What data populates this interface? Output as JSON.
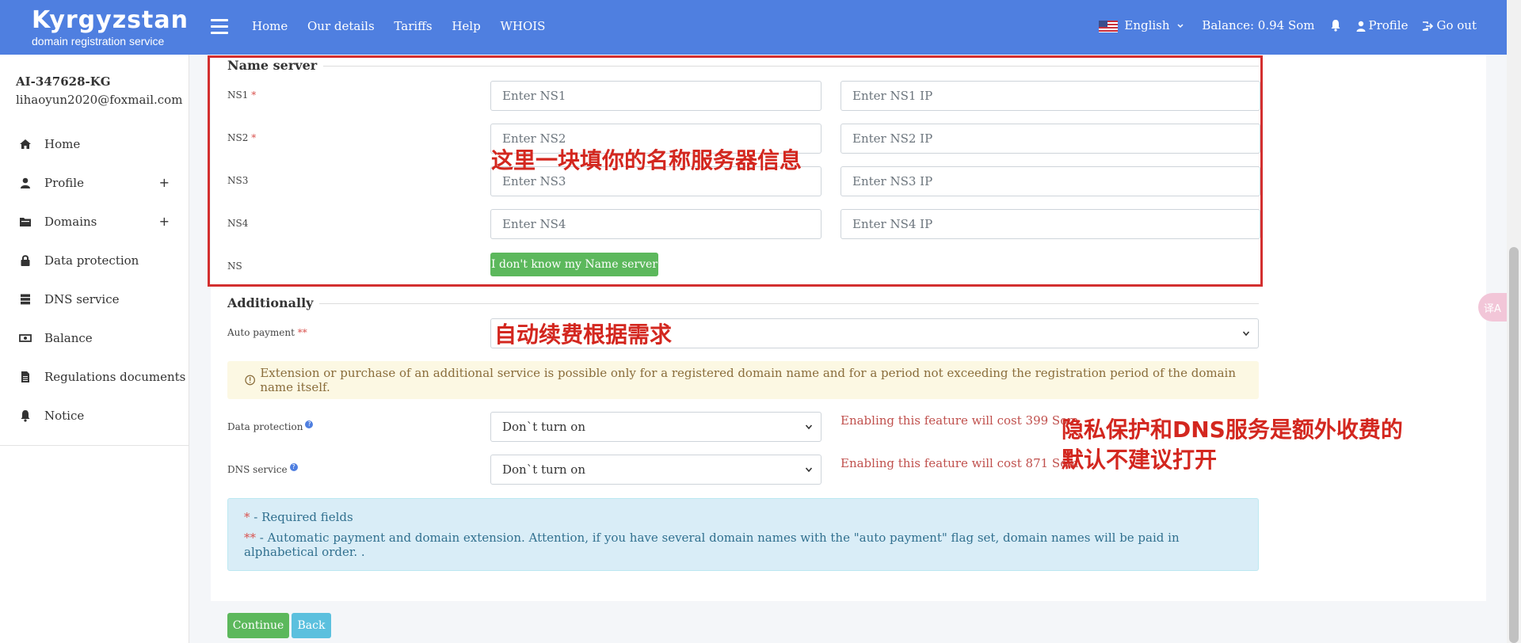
{
  "header": {
    "logo_title": "Kyrgyzstan",
    "logo_subtitle": "domain registration service",
    "nav": [
      "Home",
      "Our details",
      "Tariffs",
      "Help",
      "WHOIS"
    ],
    "language": "English",
    "balance": "Balance: 0.94 Som",
    "profile": "Profile",
    "logout": "Go out"
  },
  "sidebar": {
    "account_id": "AI-347628-KG",
    "email": "lihaoyun2020@foxmail.com",
    "items": [
      {
        "label": "Home",
        "icon": "home-icon",
        "expandable": false
      },
      {
        "label": "Profile",
        "icon": "user-icon",
        "expandable": true
      },
      {
        "label": "Domains",
        "icon": "folder-icon",
        "expandable": true
      },
      {
        "label": "Data protection",
        "icon": "lock-icon",
        "expandable": false
      },
      {
        "label": "DNS service",
        "icon": "server-icon",
        "expandable": false
      },
      {
        "label": "Balance",
        "icon": "money-icon",
        "expandable": false
      },
      {
        "label": "Regulations documents",
        "icon": "document-icon",
        "expandable": false
      },
      {
        "label": "Notice",
        "icon": "bell-icon",
        "expandable": false
      }
    ],
    "plus_symbol": "+"
  },
  "name_server": {
    "legend": "Name server",
    "rows": [
      {
        "label": "NS1",
        "required": "*",
        "ns_placeholder": "Enter NS1",
        "ip_placeholder": "Enter NS1 IP"
      },
      {
        "label": "NS2",
        "required": "*",
        "ns_placeholder": "Enter NS2",
        "ip_placeholder": "Enter NS2 IP"
      },
      {
        "label": "NS3",
        "required": "",
        "ns_placeholder": "Enter NS3",
        "ip_placeholder": "Enter NS3 IP"
      },
      {
        "label": "NS4",
        "required": "",
        "ns_placeholder": "Enter NS4",
        "ip_placeholder": "Enter NS4 IP"
      }
    ],
    "ns_label": "NS",
    "unknown_button": "I don't know my Name server"
  },
  "additionally": {
    "legend": "Additionally",
    "auto_payment_label": "Auto payment",
    "auto_payment_required": "**",
    "auto_payment_value": "",
    "warning": "Extension or purchase of an additional service is possible only for a registered domain name and for a period not exceeding the registration period of the domain name itself.",
    "data_protection_label": "Data protection",
    "data_protection_value": "Don`t turn on",
    "data_protection_cost": "Enabling this feature will cost 399 Som.",
    "dns_service_label": "DNS service",
    "dns_service_value": "Don`t turn on",
    "dns_service_cost": "Enabling this feature will cost 871 Som.",
    "help_mark": "?"
  },
  "info": {
    "required_mark": "*",
    "required_text": " - Required fields",
    "auto_mark": "**",
    "auto_text": " - Automatic payment and domain extension. Attention, if you have several domain names with the \"auto payment\" flag set, domain names will be paid in alphabetical order. ."
  },
  "buttons": {
    "continue": "Continue",
    "back": "Back"
  },
  "annotations": {
    "name_server_note": "这里一块填你的名称服务器信息",
    "auto_payment_note": "自动续费根据需求",
    "extra_fee_note_line1": "隐私保护和DNS服务是额外收费的",
    "extra_fee_note_line2": "默认不建议打开"
  },
  "translate_button": "译A",
  "colors": {
    "header_bg": "#4f7fe0",
    "annotation_red": "#d3271f",
    "button_green": "#5cb85c",
    "button_blue": "#5bc0de"
  }
}
